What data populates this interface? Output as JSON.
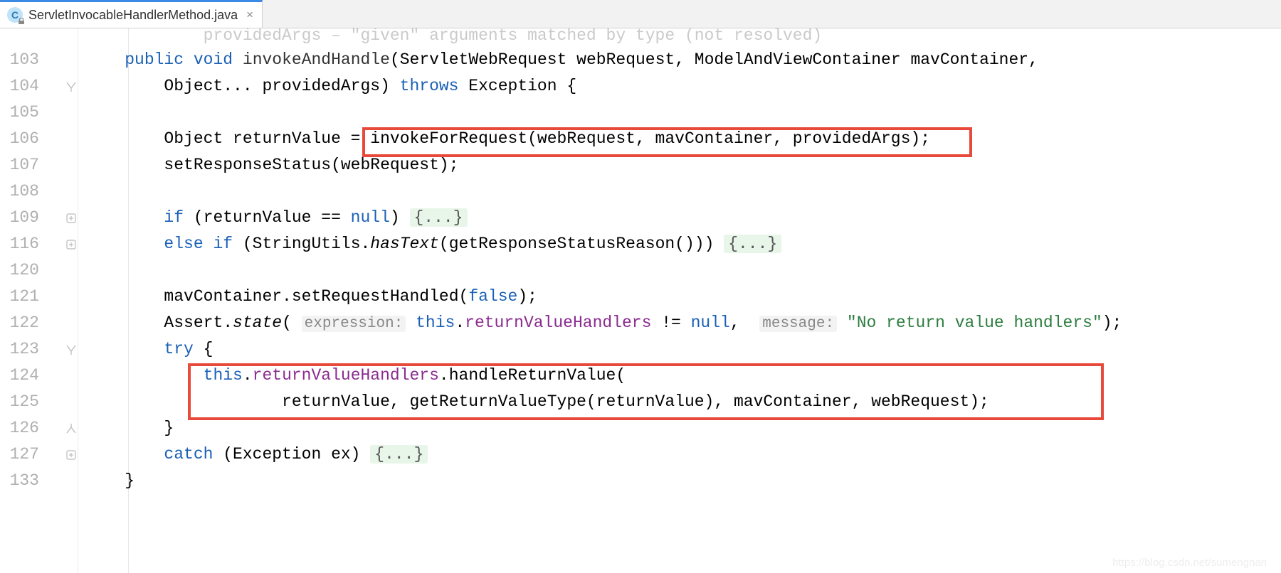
{
  "tab": {
    "icon_letter": "C",
    "filename": "ServletInvocableHandlerMethod.java",
    "close": "×"
  },
  "gutter": [
    "103",
    "104",
    "105",
    "106",
    "107",
    "108",
    "109",
    "116",
    "120",
    "121",
    "122",
    "123",
    "124",
    "125",
    "126",
    "127",
    "133"
  ],
  "cut": {
    "text": "providedArgs – \"given\" arguments matched by type (not resolved)"
  },
  "code": {
    "l103": {
      "public": "public",
      "void": "void",
      "method": "invokeAndHandle",
      "rest": "(ServletWebRequest webRequest, ModelAndViewContainer mavContainer,"
    },
    "l104": {
      "lead": "        Object... providedArgs) ",
      "throws": "throws",
      "rest": " Exception {"
    },
    "l106": {
      "lead": "    Object returnValue = ",
      "call": "invokeForRequest(webRequest, mavContainer, providedArgs);"
    },
    "l107": {
      "text": "    setResponseStatus(webRequest);"
    },
    "l109": {
      "if": "if",
      "cond": " (returnValue == ",
      "null": "null",
      "close": ") ",
      "fold": "{...}"
    },
    "l116": {
      "else": "else",
      "if": "if",
      "open": " (StringUtils.",
      "hasText": "hasText",
      "rest": "(getResponseStatusReason())) ",
      "fold": "{...}"
    },
    "l121": {
      "lead": "    mavContainer.setRequestHandled(",
      "false": "false",
      "close": ");"
    },
    "l122": {
      "lead": "    Assert.",
      "state": "state",
      "open": "( ",
      "hint1": "expression:",
      "sp1": " ",
      "this": "this",
      "dot": ".",
      "field": "returnValueHandlers",
      "neq": " != ",
      "null": "null",
      "comma": ",  ",
      "hint2": "message:",
      "sp2": " ",
      "str": "\"No return value handlers\"",
      "close": ");"
    },
    "l123": {
      "try": "try",
      "brace": " {"
    },
    "l124": {
      "lead": "        ",
      "this": "this",
      "dot": ".",
      "field": "returnValueHandlers",
      "rest": ".handleReturnValue("
    },
    "l125": {
      "text": "                returnValue, getReturnValueType(returnValue), mavContainer, webRequest);"
    },
    "l126": {
      "text": "    }"
    },
    "l127": {
      "catch": "catch",
      "rest": " (Exception ex) ",
      "fold": "{...}"
    },
    "l133": {
      "text": "}"
    }
  },
  "watermark": "https://blog.csdn.net/sumengnan"
}
